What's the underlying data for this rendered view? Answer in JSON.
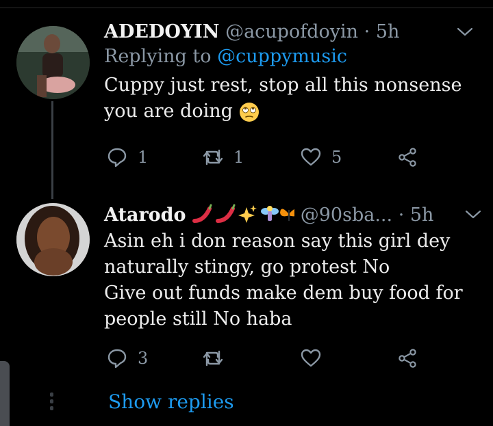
{
  "tweets": [
    {
      "name": "ADEDOYIN",
      "handle": "@acupofdoyin",
      "time": "5h",
      "replying_prefix": "Replying to",
      "replying_mention": "@cuppymusic",
      "body_lines": [
        "Cuppy just rest, stop all this nonsense",
        "you are doing"
      ],
      "emoji": "face-with-rolling-eyes",
      "reply_count": "1",
      "retweet_count": "1",
      "like_count": "5"
    },
    {
      "name": "Atarodo",
      "name_emojis": [
        "hot-pepper",
        "hot-pepper",
        "sparkles",
        "fairy",
        "butterfly"
      ],
      "handle": "@90sba...",
      "time": "5h",
      "body_lines": [
        "Asin eh i don reason say this girl dey",
        "naturally stingy, go protest No",
        "Give out funds make dem buy food for",
        "people still No haba"
      ],
      "reply_count": "3",
      "retweet_count": "",
      "like_count": ""
    }
  ],
  "show_replies_label": "Show replies",
  "separator": "·",
  "colors": {
    "background": "#000000",
    "accent": "#1d9bf0",
    "muted": "#8b98a5"
  }
}
